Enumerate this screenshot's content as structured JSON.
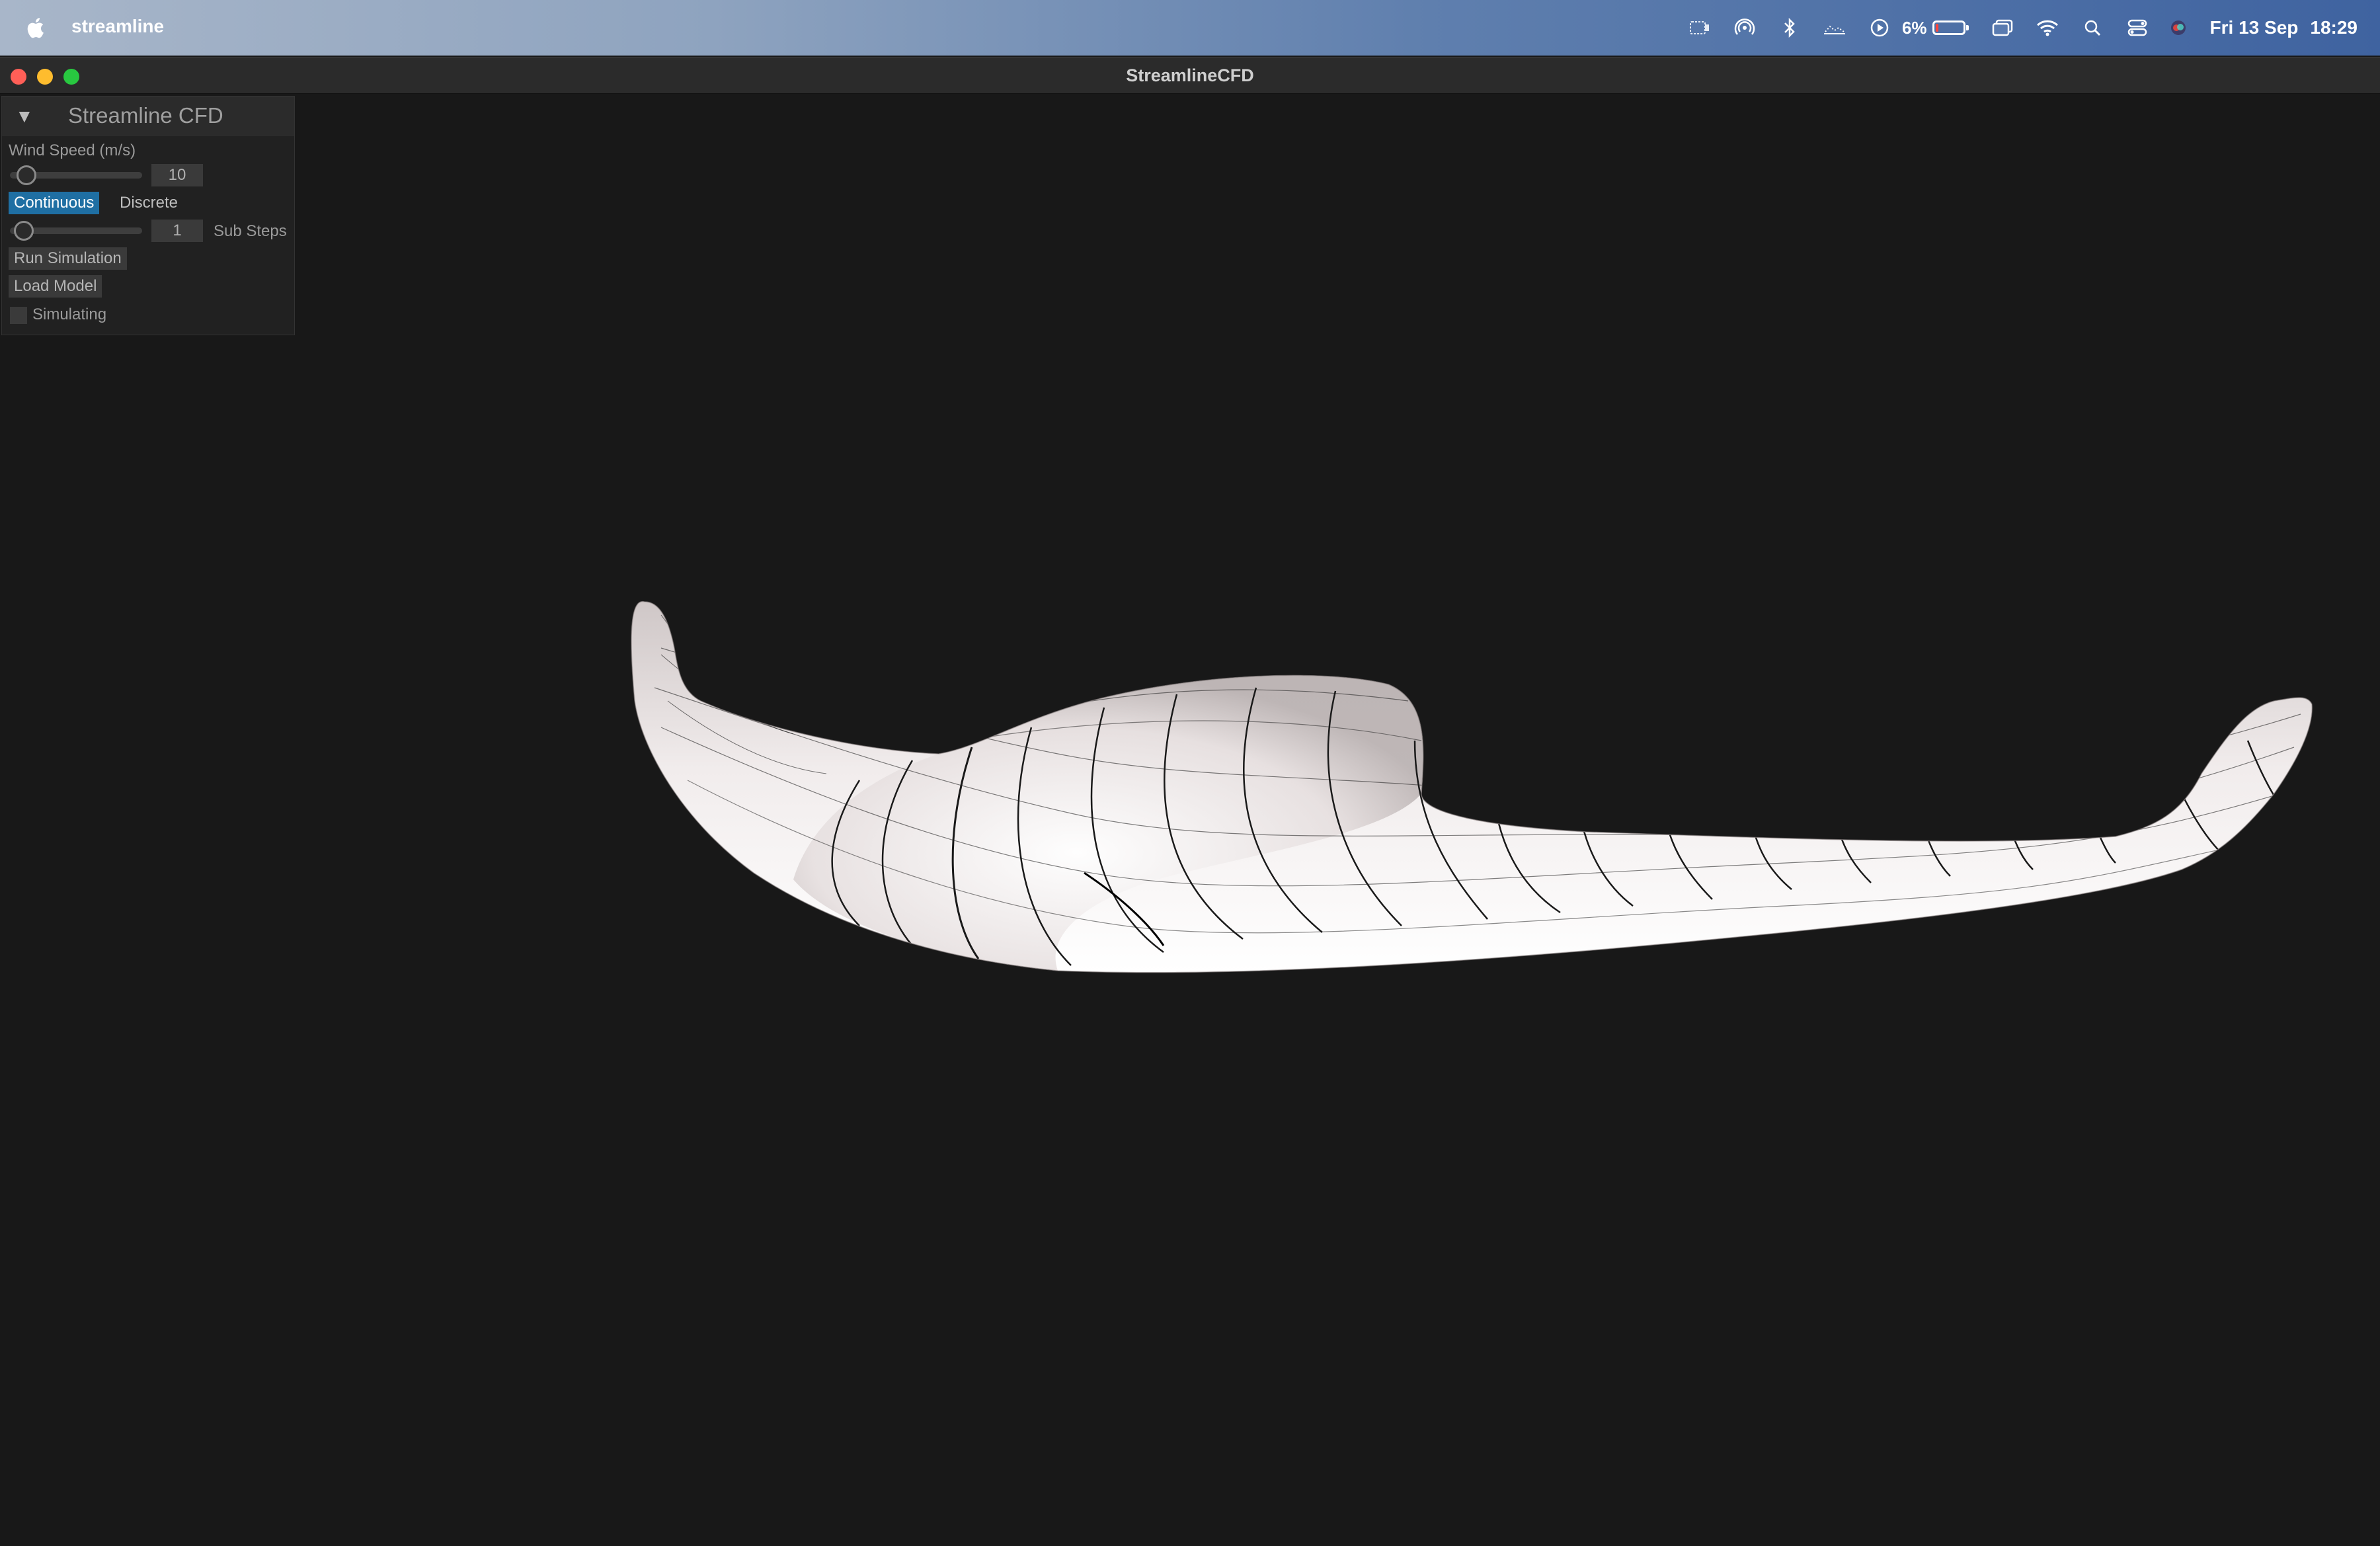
{
  "menubar": {
    "app_name": "streamline",
    "battery_percent": "6%",
    "date": "Fri 13 Sep",
    "time": "18:29",
    "icons": [
      "display-icon",
      "airdrop-icon",
      "bluetooth-icon",
      "stage-manager-icon",
      "play-icon",
      "battery-icon",
      "mirroring-icon",
      "wifi-icon",
      "search-icon",
      "control-center-icon",
      "siri-icon"
    ]
  },
  "window": {
    "title": "StreamlineCFD"
  },
  "panel": {
    "title": "Streamline CFD",
    "collapse_glyph": "▼",
    "wind_speed_label": "Wind Speed (m/s)",
    "wind_speed_value": "10",
    "mode_options": [
      "Continuous",
      "Discrete"
    ],
    "selected_mode": "Continuous",
    "sub_steps_value": "1",
    "sub_steps_label": "Sub Steps",
    "run_button": "Run Simulation",
    "load_button": "Load Model",
    "simulating_label": "Simulating",
    "simulating_checked": false
  },
  "colors": {
    "viewport_bg": "#181818",
    "accent": "#1f6fa3",
    "model_surface": "#ece6e6"
  }
}
